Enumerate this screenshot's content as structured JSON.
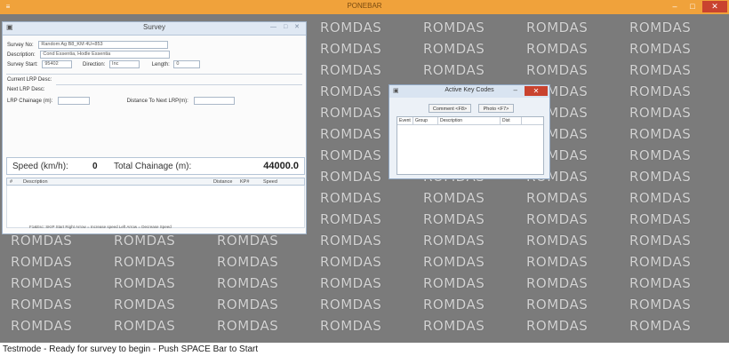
{
  "app": {
    "title": "PONEBAR"
  },
  "watermark": {
    "text": "ROMDAS"
  },
  "survey": {
    "title": "Survey",
    "survey_no_label": "Survey No:",
    "survey_no_value": "Random Ag B8_KM 4U+853",
    "description_label": "Description:",
    "description_value": "Cond Essentia, Hodle Essentia",
    "survey_start_label": "Survey Start:",
    "survey_start_value": "95402",
    "direction_label": "Direction:",
    "direction_value": "Inc",
    "length_label": "Length:",
    "length_value": "0",
    "current_lrp_label": "Current LRP Desc:",
    "next_lrp_label": "Next LRP Desc:",
    "lrp_chainage_label": "LRP Chainage (m):",
    "distance_next_lrp_label": "Distance To Next LRP(m):",
    "speed_label": "Speed (km/h):",
    "speed_value": "0",
    "total_chainage_label": "Total Chainage (m):",
    "total_chainage_value": "44000.0",
    "list_headers": [
      "#",
      "Description",
      "Distance",
      "KP#",
      "Speed"
    ],
    "hint": "F1&Esc: SKIP Start Right Arrow = Increase speed Left Arrow = Decrease Speed"
  },
  "active_key_codes": {
    "title": "Active Key Codes",
    "buttons": {
      "comment": "Comment <F8>",
      "photo": "Photo <F7>"
    },
    "columns": [
      "Event",
      "Group",
      "Description",
      "Dist"
    ]
  },
  "status": {
    "text": "Testmode - Ready for survey to begin - Push SPACE Bar to Start"
  }
}
